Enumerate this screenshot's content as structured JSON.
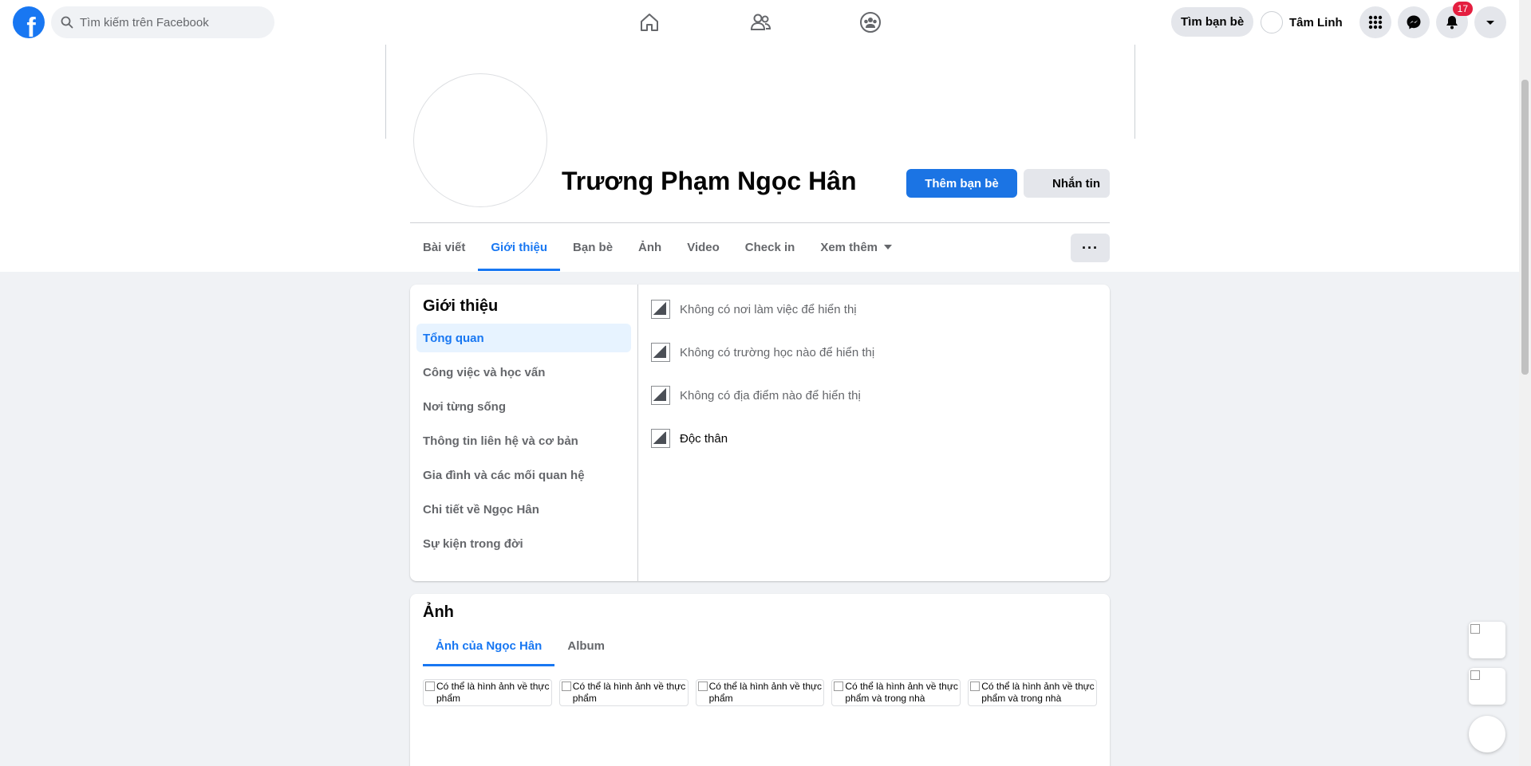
{
  "header": {
    "search_placeholder": "Tìm kiếm trên Facebook",
    "find_friends": "Tìm bạn bè",
    "user_name": "Tâm Linh",
    "notification_count": "17",
    "accent": "#1877f2"
  },
  "profile": {
    "name": "Trương Phạm Ngọc Hân",
    "add_friend": "Thêm bạn bè",
    "message": "Nhắn tin",
    "more": "···"
  },
  "tabs": [
    {
      "label": "Bài viết"
    },
    {
      "label": "Giới thiệu"
    },
    {
      "label": "Bạn bè"
    },
    {
      "label": "Ảnh"
    },
    {
      "label": "Video"
    },
    {
      "label": "Check in"
    },
    {
      "label": "Xem thêm"
    }
  ],
  "about": {
    "title": "Giới thiệu",
    "menu": [
      "Tổng quan",
      "Công việc và học vấn",
      "Nơi từng sống",
      "Thông tin liên hệ và cơ bản",
      "Gia đình và các mối quan hệ",
      "Chi tiết về Ngọc Hân",
      "Sự kiện trong đời"
    ],
    "overview": [
      "Không có nơi làm việc để hiển thị",
      "Không có trường học nào để hiển thị",
      "Không có địa điểm nào để hiển thị",
      "Độc thân"
    ]
  },
  "photos": {
    "title": "Ảnh",
    "tabs": [
      "Ảnh của Ngọc Hân",
      "Album"
    ],
    "items": [
      "Có thể là hình ảnh về thực phẩm",
      "Có thể là hình ảnh về thực phẩm",
      "Có thể là hình ảnh về thực phẩm",
      "Có thể là hình ảnh về thực phẩm và trong nhà",
      "Có thể là hình ảnh về thực phẩm và trong nhà"
    ]
  }
}
